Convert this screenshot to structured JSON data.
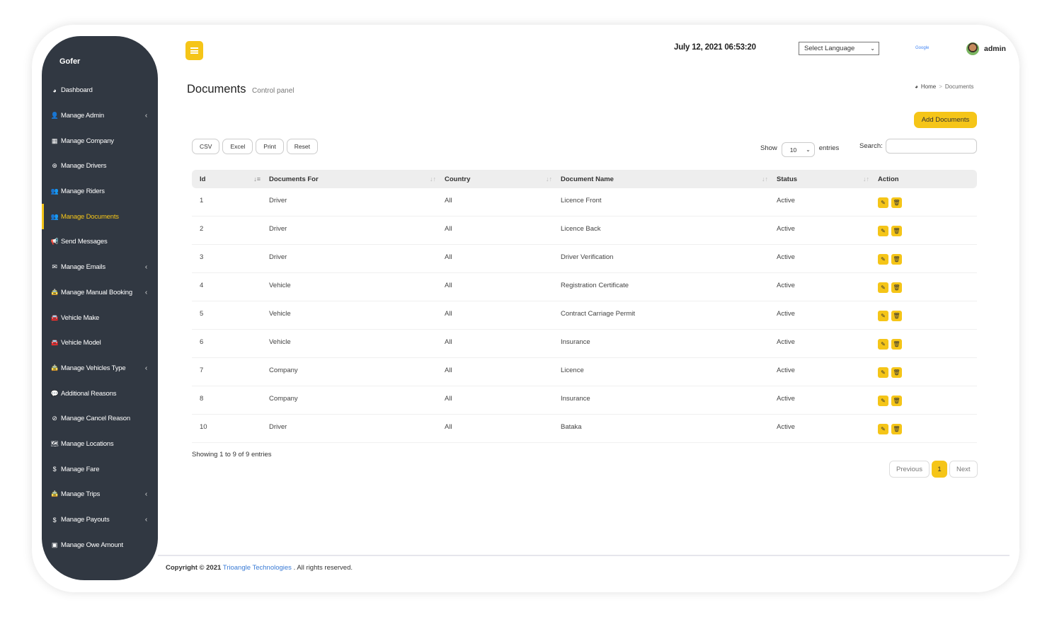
{
  "sidebar": {
    "brand": "Gofer",
    "items": [
      {
        "label": "Dashboard",
        "icon": "dashboard-icon",
        "glyph": "◕",
        "caret": false,
        "active": false
      },
      {
        "label": "Manage Admin",
        "icon": "user-plus-icon",
        "glyph": "👤",
        "caret": true,
        "active": false
      },
      {
        "label": "Manage Company",
        "icon": "building-icon",
        "glyph": "▦",
        "caret": false,
        "active": false
      },
      {
        "label": "Manage Drivers",
        "icon": "steering-wheel-icon",
        "glyph": "⊛",
        "caret": false,
        "active": false
      },
      {
        "label": "Manage Riders",
        "icon": "users-icon",
        "glyph": "👥",
        "caret": false,
        "active": false
      },
      {
        "label": "Manage Documents",
        "icon": "users-icon",
        "glyph": "👥",
        "caret": false,
        "active": true
      },
      {
        "label": "Send Messages",
        "icon": "bullhorn-icon",
        "glyph": "📢",
        "caret": false,
        "active": false
      },
      {
        "label": "Manage Emails",
        "icon": "envelope-icon",
        "glyph": "✉",
        "caret": true,
        "active": false
      },
      {
        "label": "Manage Manual Booking",
        "icon": "taxi-icon",
        "glyph": "🚖",
        "caret": true,
        "active": false
      },
      {
        "label": "Vehicle Make",
        "icon": "car-icon",
        "glyph": "🚘",
        "caret": false,
        "active": false
      },
      {
        "label": "Vehicle Model",
        "icon": "car-icon",
        "glyph": "🚘",
        "caret": false,
        "active": false
      },
      {
        "label": "Manage Vehicles Type",
        "icon": "taxi-icon",
        "glyph": "🚖",
        "caret": true,
        "active": false
      },
      {
        "label": "Additional Reasons",
        "icon": "comment-icon",
        "glyph": "💬",
        "caret": false,
        "active": false
      },
      {
        "label": "Manage Cancel Reason",
        "icon": "ban-icon",
        "glyph": "⊘",
        "caret": false,
        "active": false
      },
      {
        "label": "Manage Locations",
        "icon": "map-icon",
        "glyph": "🗺",
        "caret": false,
        "active": false
      },
      {
        "label": "Manage Fare",
        "icon": "dollar-icon",
        "glyph": "$",
        "caret": false,
        "active": false
      },
      {
        "label": "Manage Trips",
        "icon": "taxi-icon",
        "glyph": "🚖",
        "caret": true,
        "active": false
      },
      {
        "label": "Manage Payouts",
        "icon": "dollar-icon",
        "glyph": "$",
        "caret": true,
        "active": false
      },
      {
        "label": "Manage Owe Amount",
        "icon": "money-icon",
        "glyph": "▣",
        "caret": false,
        "active": false
      }
    ]
  },
  "header": {
    "datetime": "July 12, 2021 06:53:20",
    "language_select": "Select Language",
    "google_label": "Google",
    "user_name": "admin"
  },
  "page": {
    "title": "Documents",
    "subtitle": "Control panel",
    "breadcrumb": {
      "home": "Home",
      "separator": ">",
      "current": "Documents"
    },
    "add_button": "Add Documents"
  },
  "toolbar": {
    "export_buttons": [
      "CSV",
      "Excel",
      "Print",
      "Reset"
    ],
    "show_label": "Show",
    "page_length": "10",
    "entries_label": "entries",
    "search_label": "Search:",
    "search_value": ""
  },
  "table": {
    "columns": [
      "Id",
      "Documents For",
      "Country",
      "Document Name",
      "Status",
      "Action"
    ],
    "rows": [
      {
        "id": "1",
        "for": "Driver",
        "country": "All",
        "name": "Licence Front",
        "status": "Active"
      },
      {
        "id": "2",
        "for": "Driver",
        "country": "All",
        "name": "Licence Back",
        "status": "Active"
      },
      {
        "id": "3",
        "for": "Driver",
        "country": "All",
        "name": "Driver Verification",
        "status": "Active"
      },
      {
        "id": "4",
        "for": "Vehicle",
        "country": "All",
        "name": "Registration Certificate",
        "status": "Active"
      },
      {
        "id": "5",
        "for": "Vehicle",
        "country": "All",
        "name": "Contract Carriage Permit",
        "status": "Active"
      },
      {
        "id": "6",
        "for": "Vehicle",
        "country": "All",
        "name": "Insurance",
        "status": "Active"
      },
      {
        "id": "7",
        "for": "Company",
        "country": "All",
        "name": "Licence",
        "status": "Active"
      },
      {
        "id": "8",
        "for": "Company",
        "country": "All",
        "name": "Insurance",
        "status": "Active"
      },
      {
        "id": "10",
        "for": "Driver",
        "country": "All",
        "name": "Bataka",
        "status": "Active"
      }
    ],
    "info": "Showing 1 to 9 of 9 entries"
  },
  "pagination": {
    "previous": "Previous",
    "current": "1",
    "next": "Next"
  },
  "footer": {
    "copyright": "Copyright © 2021",
    "company": "Trioangle Technologies",
    "suffix": ". All rights reserved."
  },
  "colors": {
    "accent": "#f5c518",
    "sidebar": "#313842",
    "link": "#3a7bd5"
  }
}
